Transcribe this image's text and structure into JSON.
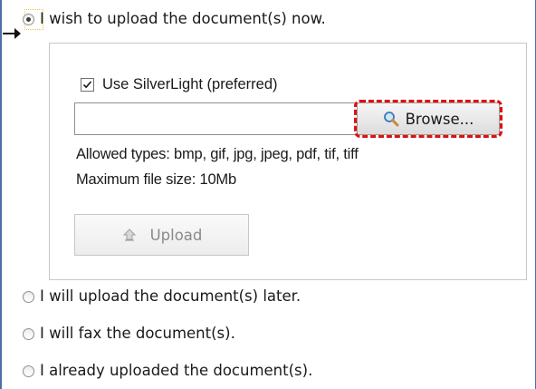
{
  "options": {
    "upload_now": "I wish to upload the document(s) now.",
    "upload_later": "I will upload the document(s) later.",
    "fax": "I will fax the document(s).",
    "already_uploaded": "I already uploaded the document(s)."
  },
  "selected_option": "upload_now",
  "upload_panel": {
    "silverlight_label": "Use SilverLight (preferred)",
    "silverlight_checked": true,
    "file_path_value": "",
    "browse_label": "Browse...",
    "allowed_types": "Allowed types: bmp, gif, jpg, jpeg, pdf, tif, tiff",
    "max_size": "Maximum file size: 10Mb",
    "upload_label": "Upload",
    "upload_enabled": false
  },
  "icons": {
    "pointer": "arrow-pointer-icon",
    "browse": "magnifier-icon",
    "upload": "upload-icon"
  },
  "colors": {
    "frame_border": "#4a6fa5",
    "highlight": "#e01010",
    "focus_outline": "#e8c64a",
    "disabled_text": "#8a8a8a"
  }
}
